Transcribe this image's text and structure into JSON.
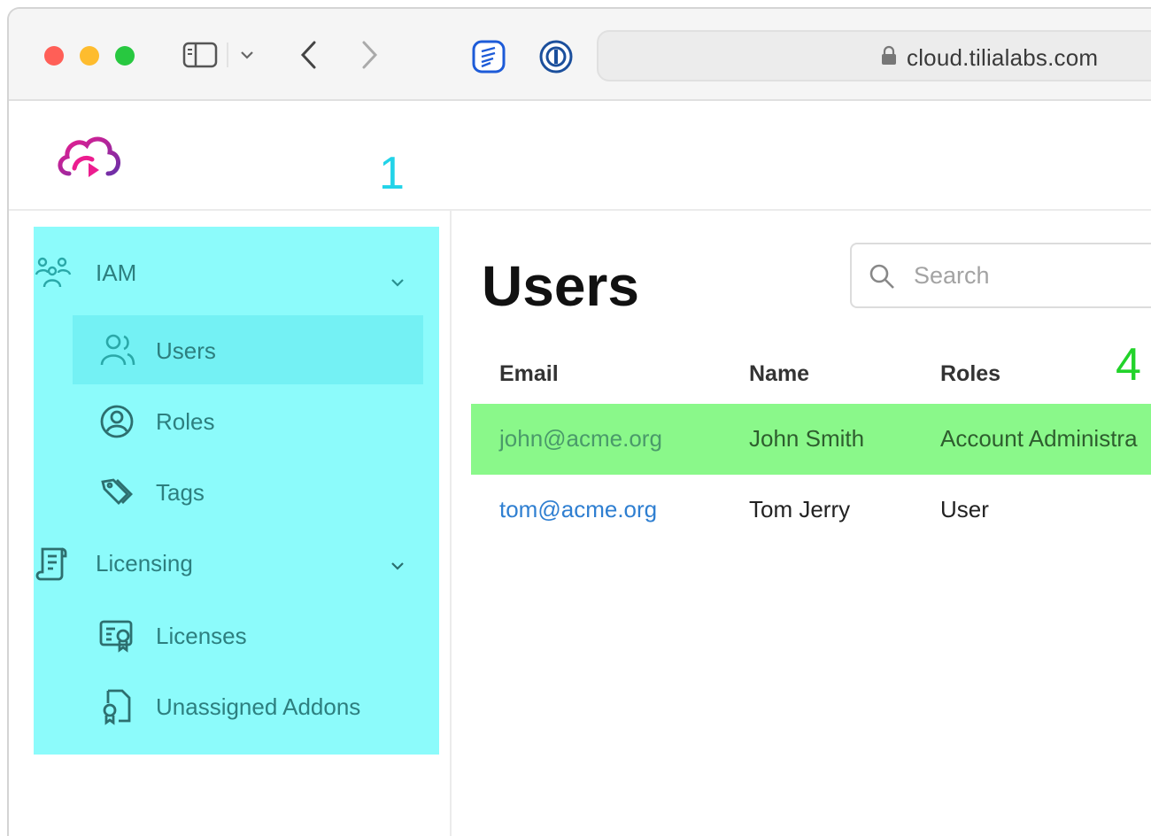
{
  "browser": {
    "address": "cloud.tilialabs.com",
    "icons": [
      "sidebar-toggle-icon",
      "chevron-down-icon",
      "back-icon",
      "forward-icon",
      "extension-icon",
      "password-manager-icon",
      "lock-icon"
    ]
  },
  "annotations": {
    "marker_1": "1",
    "marker_4": "4"
  },
  "sidebar": {
    "groups": [
      {
        "label": "IAM",
        "icon": "people-group-icon",
        "items": [
          {
            "label": "Users",
            "icon": "users-icon",
            "active": true
          },
          {
            "label": "Roles",
            "icon": "user-circle-icon"
          },
          {
            "label": "Tags",
            "icon": "tags-icon"
          }
        ]
      },
      {
        "label": "Licensing",
        "icon": "scroll-icon",
        "items": [
          {
            "label": "Licenses",
            "icon": "certificate-icon"
          },
          {
            "label": "Unassigned Addons",
            "icon": "document-badge-icon"
          }
        ]
      }
    ]
  },
  "main": {
    "title": "Users",
    "search": {
      "placeholder": "Search"
    },
    "table": {
      "headers": [
        "Email",
        "Name",
        "Roles"
      ],
      "rows": [
        {
          "email": "john@acme.org",
          "name": "John Smith",
          "roles": "Account Administra",
          "highlighted": true
        },
        {
          "email": "tom@acme.org",
          "name": "Tom Jerry",
          "roles": "User",
          "highlighted": false
        }
      ]
    }
  },
  "colors": {
    "sidebar_highlight": "#8cfbfb",
    "row_highlight": "#8af88a",
    "link": "#2f7fd1",
    "annotation_1": "#22d3e8",
    "annotation_4": "#22d32a"
  }
}
